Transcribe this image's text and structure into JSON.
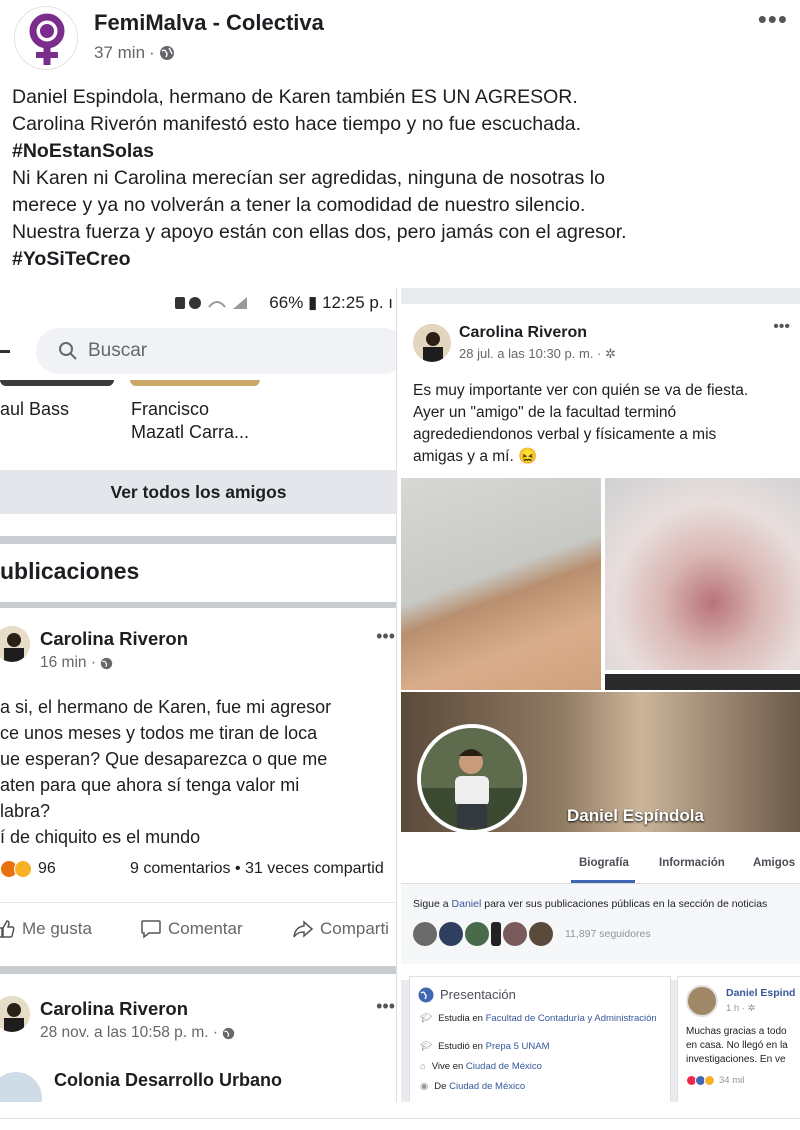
{
  "post": {
    "page_name": "FemiMalva - Colectiva",
    "time": "37 min",
    "privacy_icon": "globe-icon",
    "body_lines": [
      {
        "text": "Daniel Espindola, hermano de Karen también ES UN AGRESOR.",
        "hashtag": false
      },
      {
        "text": "Carolina Riverón manifestó esto hace tiempo y no fue escuchada.",
        "hashtag": false
      },
      {
        "text": "#NoEstanSolas",
        "hashtag": true
      },
      {
        "text": "Ni Karen ni Carolina merecían ser agredidas, ninguna de nosotras lo",
        "hashtag": false
      },
      {
        "text": "merece y ya no volverán a tener la comodidad de nuestro silencio.",
        "hashtag": false
      },
      {
        "text": "Nuestra fuerza y apoyo están con ellas dos, pero jamás con el agresor.",
        "hashtag": false
      },
      {
        "text": "#YoSiTeCreo",
        "hashtag": true
      }
    ],
    "logo_color": "#7b2d8e"
  },
  "left": {
    "status": "66% ▮ 12:25 p. ı",
    "search_placeholder": "Buscar",
    "friends": [
      "aul Bass",
      "Francisco\nMazatl Carra..."
    ],
    "friend_1": "aul Bass",
    "friend_2_line1": "Francisco",
    "friend_2_line2": "Mazatl Carra...",
    "see_all_friends": "Ver todos los amigos",
    "section_title": "ublicaciones",
    "post1": {
      "author": "Carolina Riveron",
      "time": "16 min ·",
      "lines": [
        "a si, el hermano de Karen, fue mi agresor",
        "ce unos meses y todos me tiran de loca",
        "ue esperan? Que desaparezca o que me",
        "aten para que ahora sí tenga valor mi",
        "labra?",
        "í de chiquito es el mundo"
      ],
      "reactions": "96",
      "comments_shares": "9 comentarios • 31 veces compartid",
      "like": "Me gusta",
      "comment": "Comentar",
      "share": "Comparti"
    },
    "post2": {
      "author": "Carolina Riveron",
      "time": "28 nov. a las 10:58 p. m. ·",
      "place": "Colonia Desarrollo Urbano"
    }
  },
  "right": {
    "post": {
      "author": "Carolina Riveron",
      "time": "28 jul. a las 10:30 p. m. · ✲",
      "lines": [
        "Es muy importante ver con quién se va de fiesta.",
        "Ayer un \"amigo\" de la facultad terminó",
        "agredediendonos verbal y físicamente a mis",
        "amigas y a mí. 😖"
      ]
    },
    "profile": {
      "name": "Daniel Espíndola",
      "tabs": [
        "Biografía",
        "Información",
        "Amigos"
      ],
      "follow_prefix": "Sigue a ",
      "follow_name": "Daniel",
      "follow_suffix": " para ver sus publicaciones públicas en la sección de noticias",
      "followers": "11,897 seguidores"
    },
    "presentation": {
      "title": "Presentación",
      "items": [
        {
          "icon": "graduation-icon",
          "prefix": "Estudia en ",
          "value": "Facultad de Contaduría y Administración"
        },
        {
          "icon": "graduation-icon",
          "prefix": "Estudió en ",
          "value": "Prepa 5 UNAM"
        },
        {
          "icon": "home-icon",
          "prefix": "Vive en ",
          "value": "Ciudad de México"
        },
        {
          "icon": "location-pin-icon",
          "prefix": "De ",
          "value": "Ciudad de México"
        }
      ]
    },
    "post2": {
      "author": "Daniel Espind",
      "time": "1 h · ✲",
      "lines": [
        "Muchas gracias a todo",
        "en casa. No llegó en la",
        "investigaciones. En ve"
      ],
      "reactions": "34 mil"
    }
  }
}
